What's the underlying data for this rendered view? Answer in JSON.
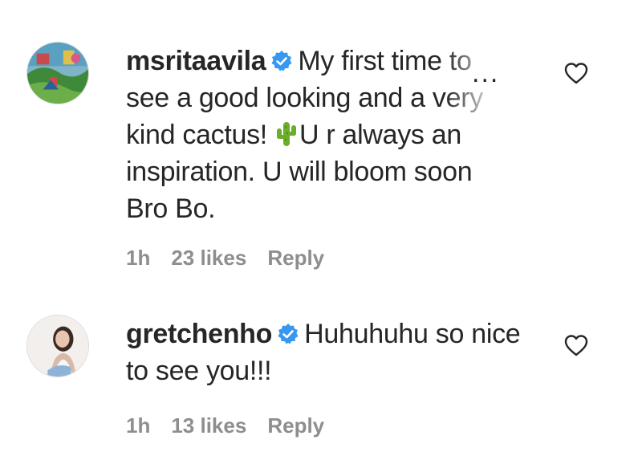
{
  "comments": [
    {
      "username": "msritaavila",
      "verified": true,
      "text_line1": "My first time to",
      "text_line2": "see a good looking and a very",
      "text_line3_a": "kind cactus!",
      "text_line3_b": "U r always an",
      "text_line4": "inspiration. U will bloom soon",
      "text_line5": "Bro Bo.",
      "more_label": "...",
      "time": "1h",
      "likes": "23 likes",
      "reply_label": "Reply",
      "avatar_icon": "landscape-painting-avatar",
      "emoji_icon": "cactus-icon"
    },
    {
      "username": "gretchenho",
      "verified": true,
      "text_line1": "Huhuhuhu so nice",
      "text_line2": "to see you!!!",
      "time": "1h",
      "likes": "13 likes",
      "reply_label": "Reply",
      "avatar_icon": "woman-portrait-avatar"
    }
  ],
  "colors": {
    "text": "#262626",
    "meta": "#8e8e8e",
    "verified_blue": "#3897f0"
  }
}
